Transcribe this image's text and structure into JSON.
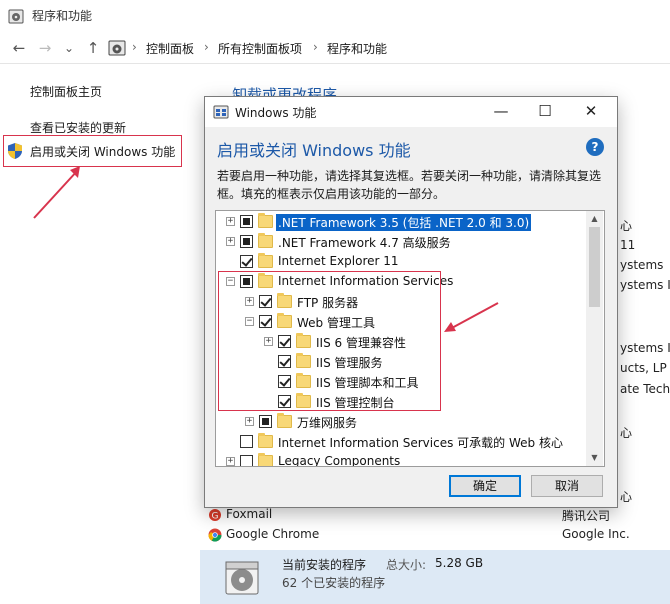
{
  "window": {
    "title": "程序和功能"
  },
  "address_bar": {
    "back": "←",
    "forward": "→",
    "dropdown": "⌄",
    "up": "↑",
    "breadcrumb": [
      "控制面板",
      "所有控制面板项",
      "程序和功能"
    ],
    "separator": "›"
  },
  "sidebar": {
    "items": [
      {
        "label": "控制面板主页"
      },
      {
        "label": "查看已安装的更新"
      },
      {
        "label": "启用或关闭 Windows 功能"
      }
    ]
  },
  "background": {
    "heading_partial": "卸载或更改程序",
    "right_fragments": [
      "心",
      "11",
      "ystems",
      "ystems Inc",
      "ystems Inc",
      "ucts, LP",
      "ate Techno",
      "心",
      "心"
    ],
    "programs": [
      {
        "name": "Foxmail",
        "publisher": "腾讯公司"
      },
      {
        "name": "Google Chrome",
        "publisher": "Google Inc."
      }
    ]
  },
  "status": {
    "title": "当前安装的程序",
    "size_label": "总大小:",
    "size_value": "5.28 GB",
    "count": "62 个已安装的程序"
  },
  "dialog": {
    "title": "Windows 功能",
    "heading": "启用或关闭 Windows 功能",
    "help": "?",
    "description": "若要启用一种功能，请选择其复选框。若要关闭一种功能，请清除其复选框。填充的框表示仅启用该功能的一部分。",
    "controls": {
      "minimize": "—",
      "maximize": "☐",
      "close": "✕"
    },
    "ok": "确定",
    "cancel": "取消",
    "features": [
      {
        "label": ".NET Framework 3.5 (包括 .NET 2.0 和 3.0)",
        "state": "partial",
        "expander": "+",
        "selected": true
      },
      {
        "label": ".NET Framework 4.7 高级服务",
        "state": "partial",
        "expander": "+"
      },
      {
        "label": "Internet Explorer 11",
        "state": "checked",
        "expander": ""
      },
      {
        "label": "Internet Information Services",
        "state": "partial",
        "expander": "−"
      },
      {
        "label": "FTP 服务器",
        "state": "checked",
        "expander": "+"
      },
      {
        "label": "Web 管理工具",
        "state": "checked",
        "expander": "−"
      },
      {
        "label": "IIS 6 管理兼容性",
        "state": "checked",
        "expander": "+"
      },
      {
        "label": "IIS 管理服务",
        "state": "checked",
        "expander": ""
      },
      {
        "label": "IIS 管理脚本和工具",
        "state": "checked",
        "expander": ""
      },
      {
        "label": "IIS 管理控制台",
        "state": "checked",
        "expander": ""
      },
      {
        "label": "万维网服务",
        "state": "partial",
        "expander": "+"
      },
      {
        "label": "Internet Information Services 可承载的 Web 核心",
        "state": "unchecked",
        "expander": ""
      },
      {
        "label": "Legacy Components",
        "state": "unchecked",
        "expander": "+"
      }
    ]
  }
}
